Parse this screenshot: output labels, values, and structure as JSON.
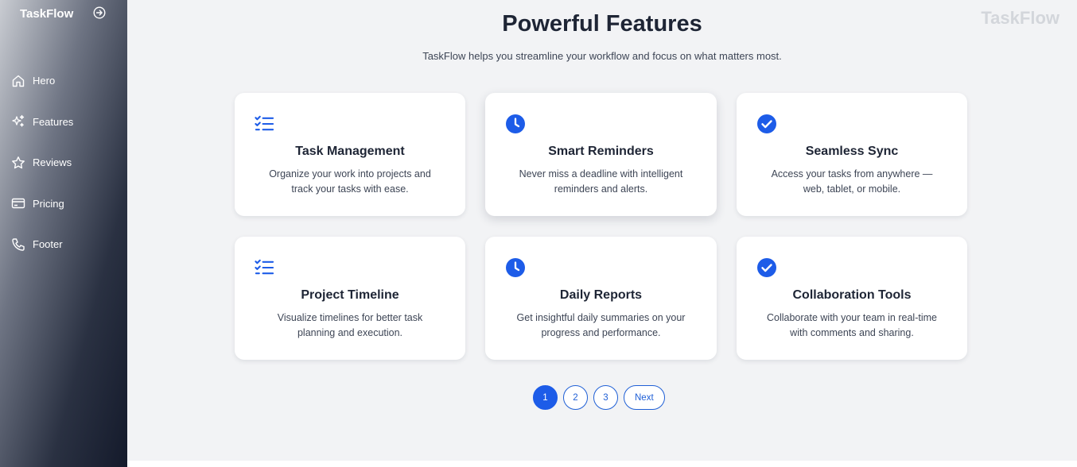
{
  "sidebar": {
    "brand": "TaskFlow",
    "collapse_icon": "arrow-right-circle-icon",
    "items": [
      {
        "label": "Hero",
        "icon": "home-icon"
      },
      {
        "label": "Features",
        "icon": "sparkles-icon"
      },
      {
        "label": "Reviews",
        "icon": "star-icon"
      },
      {
        "label": "Pricing",
        "icon": "credit-card-icon"
      },
      {
        "label": "Footer",
        "icon": "phone-icon"
      }
    ]
  },
  "main": {
    "watermark": "TaskFlow",
    "title": "Powerful Features",
    "subtitle": "TaskFlow helps you streamline your workflow and focus on what matters most.",
    "accent_color": "#1d5ce8",
    "features": [
      {
        "title": "Task Management",
        "description": "Organize your work into projects and track your tasks with ease.",
        "icon": "task-list-icon"
      },
      {
        "title": "Smart Reminders",
        "description": "Never miss a deadline with intelligent reminders and alerts.",
        "icon": "clock-icon"
      },
      {
        "title": "Seamless Sync",
        "description": "Access your tasks from anywhere — web, tablet, or mobile.",
        "icon": "check-circle-icon"
      },
      {
        "title": "Project Timeline",
        "description": "Visualize timelines for better task planning and execution.",
        "icon": "task-list-icon"
      },
      {
        "title": "Daily Reports",
        "description": "Get insightful daily summaries on your progress and performance.",
        "icon": "clock-icon"
      },
      {
        "title": "Collaboration Tools",
        "description": "Collaborate with your team in real-time with comments and sharing.",
        "icon": "check-circle-icon"
      }
    ],
    "pagination": {
      "pages": [
        "1",
        "2",
        "3"
      ],
      "current": "1",
      "next_label": "Next"
    }
  }
}
